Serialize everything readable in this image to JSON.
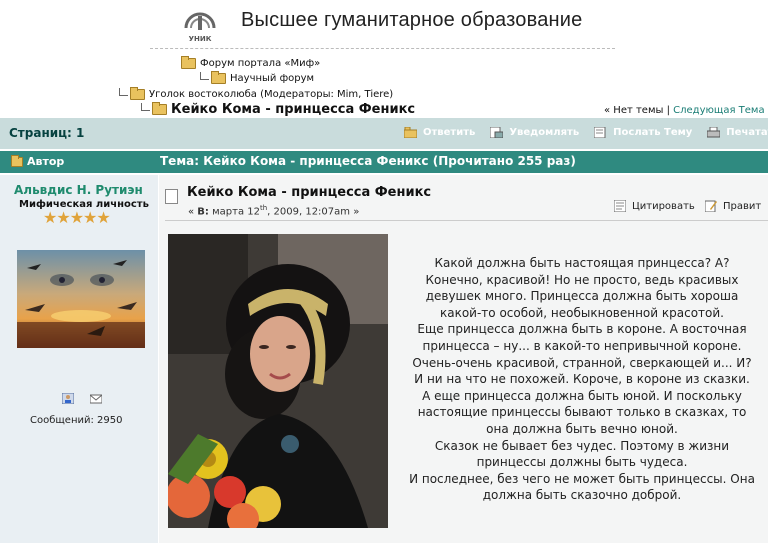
{
  "header": {
    "site_title": "Высшее гуманитарное образование",
    "logo_text": "УНИК"
  },
  "breadcrumbs": [
    "Форум портала «Миф»",
    "Научный форум",
    "Уголок востоколюба (Модераторы: Mim, Tiere)",
    "Кейко Кома - принцесса Феникс"
  ],
  "topic_nav": {
    "prev": "« Нет темы",
    "separator": "|",
    "next": "Следующая Тема"
  },
  "toolbar": {
    "pages_label": "Страниц: 1",
    "actions": [
      "Ответить",
      "Уведомлять",
      "Послать Тему",
      "Печатать"
    ]
  },
  "header_bar": {
    "author_label": "Автор",
    "topic_label": "Тема: Кейко Кома - принцесса Феникс  (Прочитано 255 раз)"
  },
  "author": {
    "name": "Альвдис Н. Рутиэн",
    "title": "Мифическая личность",
    "stars": "★★★★★",
    "posts_label": "Сообщений: 2950"
  },
  "post": {
    "title": "Кейко Кома - принцесса Феникс",
    "date_prefix": "« ",
    "date_on": "В:",
    "date_month": " марта 12",
    "date_sup": "th",
    "date_rest": ", 2009, 12:07am »",
    "quote_label": "Цитировать",
    "edit_label": "Правит",
    "paragraphs": [
      "Какой должна быть настоящая принцесса? А?",
      "Конечно, красивой! Но не просто, ведь красивых",
      "девушек много. Принцесса должна быть хороша",
      "какой-то особой, необыкновенной красотой.",
      "Еще принцесса должна быть в короне. А восточная",
      "принцесса – ну... в какой-то непривычной короне.",
      "Очень-очень красивой, странной, сверкающей и... И?",
      "И ни на что не похожей. Короче, в короне из сказки.",
      "А еще принцесса должна быть юной. И поскольку",
      "настоящие принцессы бывают только в сказках, то",
      "она должна быть вечно юной.",
      "Сказок не бывает без чудес. Поэтому в жизни",
      "принцессы должны быть чудеса.",
      "И последнее, без чего не может быть принцессы. Она",
      "должна быть сказочно доброй."
    ]
  },
  "colors": {
    "bar_light": "#c9dcdc",
    "bar_dark": "#2f8a80",
    "username": "#1f8b6e",
    "link": "#1a7d75"
  }
}
